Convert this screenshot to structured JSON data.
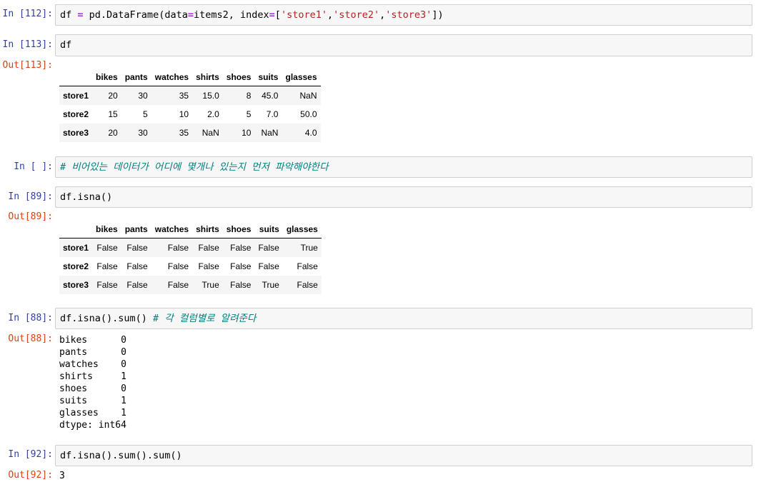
{
  "cells": [
    {
      "prompt": "In [112]:",
      "code": [
        {
          "t": "df ",
          "c": ""
        },
        {
          "t": "=",
          "c": "op"
        },
        {
          "t": " pd.DataFrame(data",
          "c": ""
        },
        {
          "t": "=",
          "c": "op"
        },
        {
          "t": "items2, index",
          "c": ""
        },
        {
          "t": "=",
          "c": "op"
        },
        {
          "t": "[",
          "c": ""
        },
        {
          "t": "'store1'",
          "c": "str"
        },
        {
          "t": ",",
          "c": ""
        },
        {
          "t": "'store2'",
          "c": "str"
        },
        {
          "t": ",",
          "c": ""
        },
        {
          "t": "'store3'",
          "c": "str"
        },
        {
          "t": "])",
          "c": ""
        }
      ]
    },
    {
      "prompt": "In [113]:",
      "code": [
        {
          "t": "df",
          "c": ""
        }
      ],
      "out_prompt": "Out[113]:"
    },
    {
      "prompt": "In [ ]:",
      "code": [
        {
          "t": "# 비어있는 데이터가 어디에 몇개나 있는지 먼저 파악해야한다",
          "c": "cm"
        }
      ]
    },
    {
      "prompt": "In [89]:",
      "code": [
        {
          "t": "df.isna()",
          "c": ""
        }
      ],
      "out_prompt": "Out[89]:"
    },
    {
      "prompt": "In [88]:",
      "code": [
        {
          "t": "df.isna().sum() ",
          "c": ""
        },
        {
          "t": "# 각 컬럼별로 알려준다",
          "c": "cm"
        }
      ],
      "out_prompt": "Out[88]:"
    },
    {
      "prompt": "In [92]:",
      "code": [
        {
          "t": "df.isna().sum().sum()",
          "c": ""
        }
      ],
      "out_prompt": "Out[92]:"
    }
  ],
  "table1": {
    "columns": [
      "",
      "bikes",
      "pants",
      "watches",
      "shirts",
      "shoes",
      "suits",
      "glasses"
    ],
    "rows": [
      [
        "store1",
        "20",
        "30",
        "35",
        "15.0",
        "8",
        "45.0",
        "NaN"
      ],
      [
        "store2",
        "15",
        "5",
        "10",
        "2.0",
        "5",
        "7.0",
        "50.0"
      ],
      [
        "store3",
        "20",
        "30",
        "35",
        "NaN",
        "10",
        "NaN",
        "4.0"
      ]
    ]
  },
  "table2": {
    "columns": [
      "",
      "bikes",
      "pants",
      "watches",
      "shirts",
      "shoes",
      "suits",
      "glasses"
    ],
    "rows": [
      [
        "store1",
        "False",
        "False",
        "False",
        "False",
        "False",
        "False",
        "True"
      ],
      [
        "store2",
        "False",
        "False",
        "False",
        "False",
        "False",
        "False",
        "False"
      ],
      [
        "store3",
        "False",
        "False",
        "False",
        "True",
        "False",
        "True",
        "False"
      ]
    ]
  },
  "series_output": [
    "bikes      0",
    "pants      0",
    "watches    0",
    "shirts     1",
    "shoes      0",
    "suits      1",
    "glasses    1",
    "dtype: int64"
  ],
  "sum_output": "3"
}
